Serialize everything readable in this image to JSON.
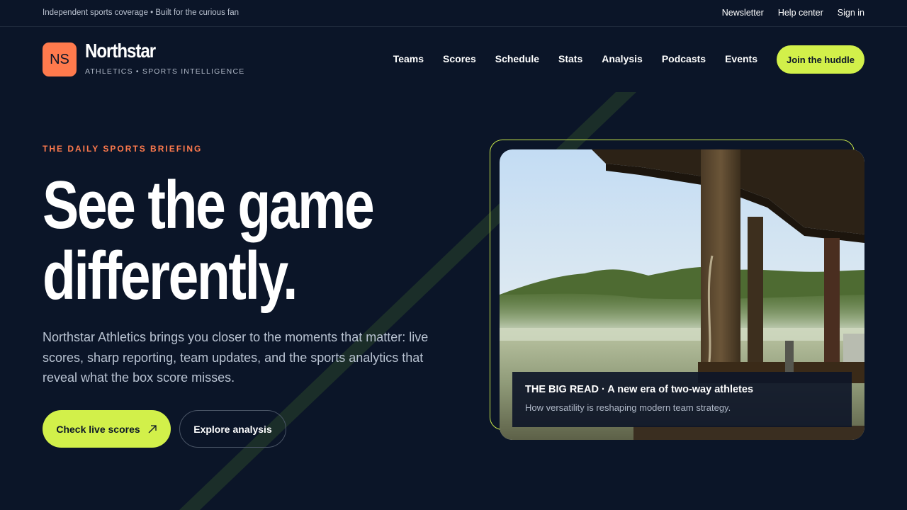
{
  "topbar": {
    "tagline": "Independent sports coverage • Built for the curious fan",
    "links": [
      "Newsletter",
      "Help center",
      "Sign in"
    ]
  },
  "brand": {
    "badge": "NS",
    "name": "Northstar",
    "subtitle": "ATHLETICS • SPORTS INTELLIGENCE"
  },
  "nav": {
    "items": [
      "Teams",
      "Scores",
      "Schedule",
      "Stats",
      "Analysis",
      "Podcasts",
      "Events"
    ],
    "cta": "Join the huddle"
  },
  "hero": {
    "eyebrow": "THE DAILY SPORTS BRIEFING",
    "headline_line1": "See the game",
    "headline_line2": "differently.",
    "lede": "Northstar Athletics brings you closer to the moments that matter: live scores, sharp reporting, team updates, and the sports analytics that reveal what the box score misses.",
    "primary_button": "Check live scores",
    "primary_button_icon": "arrow-up-right-icon",
    "secondary_button": "Explore analysis"
  },
  "feature": {
    "caption_title": "THE BIG READ · A new era of two-way athletes",
    "caption_subtitle": "How versatility is reshaping modern team strategy."
  },
  "colors": {
    "background": "#0b1528",
    "accent_lime": "#d2f04a",
    "accent_orange": "#ff7a4d"
  }
}
